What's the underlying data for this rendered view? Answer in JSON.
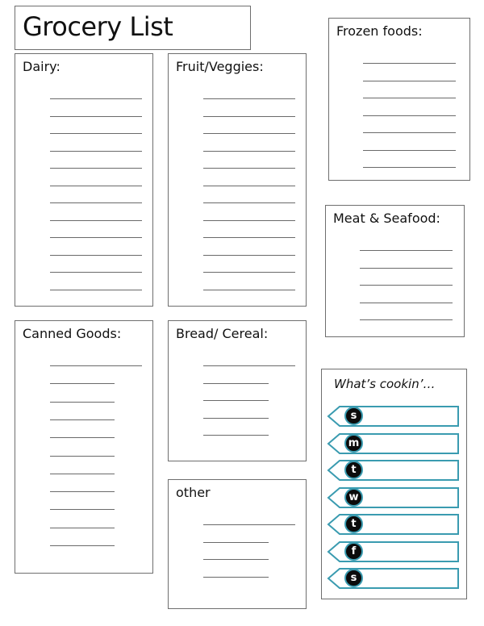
{
  "title": "Grocery List",
  "sections": {
    "dairy": {
      "label": "Dairy:",
      "line_count": 12
    },
    "fruit": {
      "label": "Fruit/Veggies:",
      "line_count": 12
    },
    "frozen": {
      "label": "Frozen foods:",
      "line_count": 7
    },
    "meat": {
      "label": "Meat & Seafood:",
      "line_count": 5
    },
    "canned": {
      "label": "Canned Goods:",
      "line_count": 11
    },
    "bread": {
      "label": "Bread/ Cereal:",
      "line_count": 5
    },
    "other": {
      "label": "other",
      "line_count": 4
    }
  },
  "meal_plan": {
    "label": "What’s cookin’…",
    "accent_color": "#3a9bb0",
    "days": [
      "s",
      "m",
      "t",
      "w",
      "t",
      "f",
      "s"
    ]
  }
}
